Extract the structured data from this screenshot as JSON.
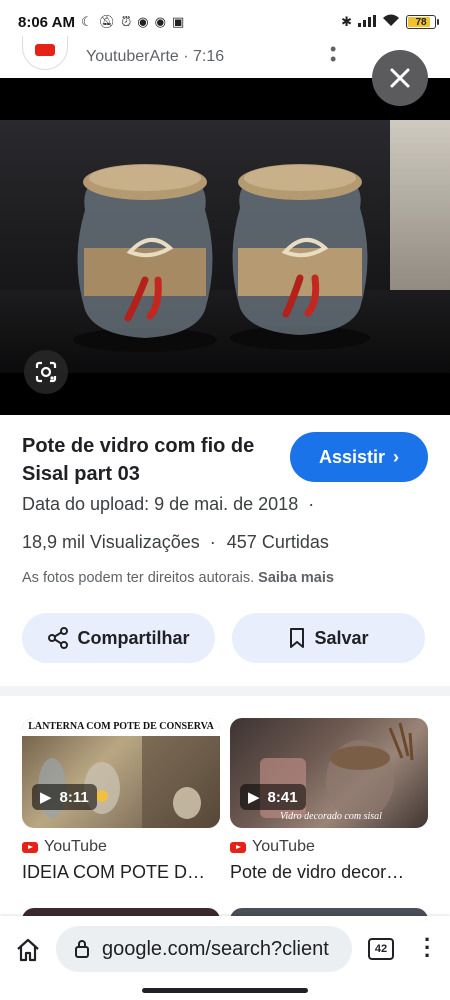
{
  "status_bar": {
    "time": "8:06 AM",
    "battery": "78",
    "battery_level": 0.78,
    "battery_color": "#f2c12e",
    "left_icons": [
      "moon-icon",
      "mute-icon",
      "alarm-icon",
      "discord-icon",
      "discord-icon",
      "instagram-icon"
    ],
    "right_icons": [
      "bluetooth-icon",
      "signal-icon",
      "wifi-icon",
      "battery-icon"
    ]
  },
  "source_header": {
    "channel": "YoutuberArte · 7:16"
  },
  "image_viewer": {
    "close_icon": "close-icon",
    "lens_icon": "google-lens-icon"
  },
  "details": {
    "title": "Pote de vidro com fio de Sisal part 03",
    "watch_button": "Assistir",
    "upload_date": "Data do upload: 9 de mai. de 2018",
    "views": "18,9 mil Visualizações",
    "likes": "457 Curtidas",
    "rights_notice": "As fotos podem ter direitos autorais.",
    "learn_more": "Saiba mais",
    "accent_color": "#1a73e8"
  },
  "actions": {
    "share": "Compartilhar",
    "save": "Salvar"
  },
  "related": [
    {
      "thumb_banner": "LANTERNA COM POTE DE CONSERVA",
      "duration": "8:11",
      "source": "YouTube",
      "title": "IDEIA COM POTE D…"
    },
    {
      "thumb_caption": "Vidro decorado com sisal",
      "duration": "8:41",
      "source": "YouTube",
      "title": "Pote de vidro decor…"
    }
  ],
  "browser": {
    "url": "google.com/search?client",
    "tab_count": "42"
  }
}
